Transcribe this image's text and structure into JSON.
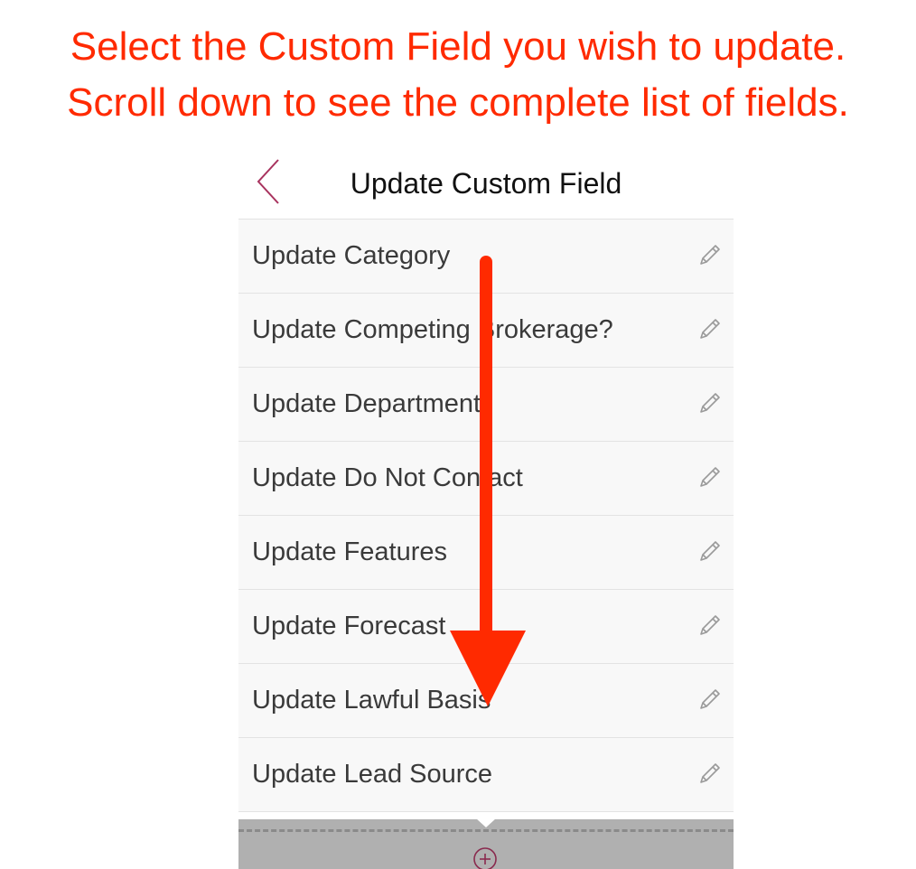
{
  "instruction": {
    "line1": "Select the Custom Field you wish to update.",
    "line2": "Scroll down to see the complete list of fields.",
    "color": "#ff2a00"
  },
  "navbar": {
    "title": "Update Custom Field",
    "back_icon": "chevron-left-icon",
    "accent": "#a8325e"
  },
  "fields": [
    {
      "label": "Update Category",
      "icon": "pencil-icon"
    },
    {
      "label": "Update Competing Brokerage?",
      "icon": "pencil-icon"
    },
    {
      "label": "Update Department",
      "icon": "pencil-icon"
    },
    {
      "label": "Update Do Not Contact",
      "icon": "pencil-icon"
    },
    {
      "label": "Update Features",
      "icon": "pencil-icon"
    },
    {
      "label": "Update Forecast",
      "icon": "pencil-icon"
    },
    {
      "label": "Update Lawful Basis",
      "icon": "pencil-icon"
    },
    {
      "label": "Update Lead Source",
      "icon": "pencil-icon"
    }
  ],
  "bottom_bar": {
    "add_icon": "plus-circle-icon"
  },
  "annotation": {
    "type": "scroll-down-arrow",
    "color": "#ff2a00"
  }
}
